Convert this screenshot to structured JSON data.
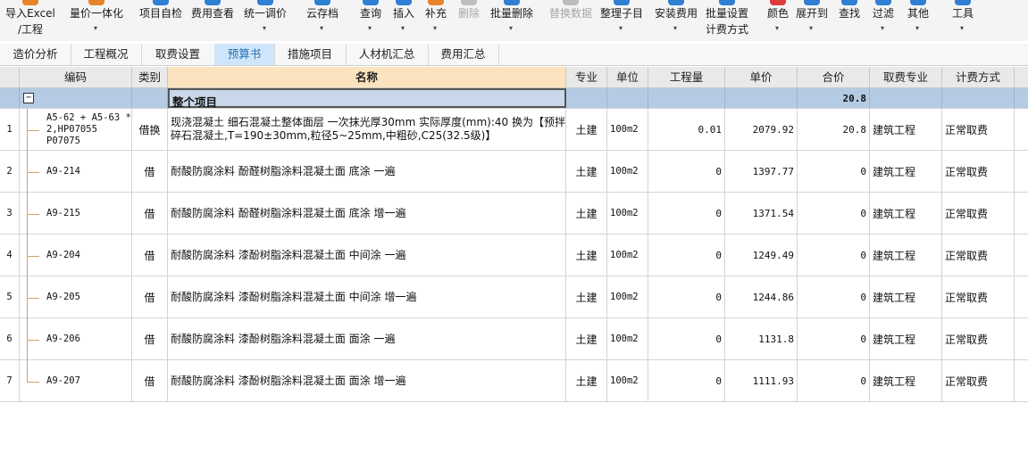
{
  "toolbar": {
    "items": [
      {
        "label": "导入Excel",
        "label2": "/工程",
        "icon": "import-excel-icon",
        "color": "#e6842a",
        "disabled": false,
        "caret": false
      },
      {
        "label": "量价一体化",
        "label2": "",
        "icon": "price-integration-icon",
        "color": "#e6842a",
        "disabled": false,
        "caret": true
      },
      {
        "label": "项目自检",
        "label2": "",
        "icon": "self-check-icon",
        "color": "#2f7fd3",
        "disabled": false,
        "caret": false
      },
      {
        "label": "费用查看",
        "label2": "",
        "icon": "fee-view-icon",
        "color": "#2f7fd3",
        "disabled": false,
        "caret": false
      },
      {
        "label": "统一调价",
        "label2": "",
        "icon": "adjust-price-icon",
        "color": "#2f7fd3",
        "disabled": false,
        "caret": true
      },
      {
        "label": "云存档",
        "label2": "",
        "icon": "cloud-archive-icon",
        "color": "#2f7fd3",
        "disabled": false,
        "caret": true
      },
      {
        "label": "查询",
        "label2": "",
        "icon": "query-icon",
        "color": "#2f7fd3",
        "disabled": false,
        "caret": true
      },
      {
        "label": "插入",
        "label2": "",
        "icon": "insert-icon",
        "color": "#2f7fd3",
        "disabled": false,
        "caret": true
      },
      {
        "label": "补充",
        "label2": "",
        "icon": "supplement-icon",
        "color": "#e6842a",
        "disabled": false,
        "caret": true
      },
      {
        "label": "删除",
        "label2": "",
        "icon": "delete-icon",
        "color": "#bdbdbd",
        "disabled": true,
        "caret": false
      },
      {
        "label": "批量删除",
        "label2": "",
        "icon": "batch-delete-icon",
        "color": "#2f7fd3",
        "disabled": false,
        "caret": true
      },
      {
        "label": "替换数据",
        "label2": "",
        "icon": "replace-data-icon",
        "color": "#bdbdbd",
        "disabled": true,
        "caret": false
      },
      {
        "label": "整理子目",
        "label2": "",
        "icon": "organize-items-icon",
        "color": "#2f7fd3",
        "disabled": false,
        "caret": true
      },
      {
        "label": "安装费用",
        "label2": "",
        "icon": "install-fee-icon",
        "color": "#2f7fd3",
        "disabled": false,
        "caret": true
      },
      {
        "label": "批量设置",
        "label2": "计费方式",
        "icon": "batch-setting-icon",
        "color": "#2f7fd3",
        "disabled": false,
        "caret": false
      },
      {
        "label": "颜色",
        "label2": "",
        "icon": "color-icon",
        "color": "#e03b3b",
        "disabled": false,
        "caret": true
      },
      {
        "label": "展开到",
        "label2": "",
        "icon": "expand-to-icon",
        "color": "#2f7fd3",
        "disabled": false,
        "caret": true
      },
      {
        "label": "查找",
        "label2": "",
        "icon": "find-icon",
        "color": "#2f7fd3",
        "disabled": false,
        "caret": false
      },
      {
        "label": "过滤",
        "label2": "",
        "icon": "filter-icon",
        "color": "#2f7fd3",
        "disabled": false,
        "caret": true
      },
      {
        "label": "其他",
        "label2": "",
        "icon": "other-icon",
        "color": "#2f7fd3",
        "disabled": false,
        "caret": true
      },
      {
        "label": "工具",
        "label2": "",
        "icon": "tools-icon",
        "color": "#2f7fd3",
        "disabled": false,
        "caret": true
      }
    ]
  },
  "tabs": [
    {
      "label": "造价分析",
      "active": false
    },
    {
      "label": "工程概况",
      "active": false
    },
    {
      "label": "取费设置",
      "active": false
    },
    {
      "label": "预算书",
      "active": true
    },
    {
      "label": "措施项目",
      "active": false
    },
    {
      "label": "人材机汇总",
      "active": false
    },
    {
      "label": "费用汇总",
      "active": false
    }
  ],
  "table": {
    "columns": [
      "编码",
      "类别",
      "名称",
      "专业",
      "单位",
      "工程量",
      "单价",
      "合价",
      "取费专业",
      "计费方式"
    ],
    "summary": {
      "collapse": "−",
      "name": "整个项目",
      "total": "20.8"
    },
    "rows": [
      {
        "no": "1",
        "code": "A5-62 + A5-63 * 2,HP07055 P07075",
        "type": "借换",
        "name": "现浇混凝土 细石混凝土整体面层 一次抹光厚30mm 实际厚度(mm):40 换为【预拌碎石混凝土,T=190±30mm,粒径5~25mm,中粗砂,C25(32.5级)】",
        "spec": "土建",
        "unit": "100m2",
        "qty": "0.01",
        "price": "2079.92",
        "total": "20.8",
        "fee_spec": "建筑工程",
        "method": "正常取费"
      },
      {
        "no": "2",
        "code": "A9-214",
        "type": "借",
        "name": "耐酸防腐涂料 酚醛树脂涂料混凝土面 底涂 一遍",
        "spec": "土建",
        "unit": "100m2",
        "qty": "0",
        "price": "1397.77",
        "total": "0",
        "fee_spec": "建筑工程",
        "method": "正常取费"
      },
      {
        "no": "3",
        "code": "A9-215",
        "type": "借",
        "name": "耐酸防腐涂料 酚醛树脂涂料混凝土面 底涂 增一遍",
        "spec": "土建",
        "unit": "100m2",
        "qty": "0",
        "price": "1371.54",
        "total": "0",
        "fee_spec": "建筑工程",
        "method": "正常取费"
      },
      {
        "no": "4",
        "code": "A9-204",
        "type": "借",
        "name": "耐酸防腐涂料 漆酚树脂涂料混凝土面 中间涂 一遍",
        "spec": "土建",
        "unit": "100m2",
        "qty": "0",
        "price": "1249.49",
        "total": "0",
        "fee_spec": "建筑工程",
        "method": "正常取费"
      },
      {
        "no": "5",
        "code": "A9-205",
        "type": "借",
        "name": "耐酸防腐涂料 漆酚树脂涂料混凝土面 中间涂 增一遍",
        "spec": "土建",
        "unit": "100m2",
        "qty": "0",
        "price": "1244.86",
        "total": "0",
        "fee_spec": "建筑工程",
        "method": "正常取费"
      },
      {
        "no": "6",
        "code": "A9-206",
        "type": "借",
        "name": "耐酸防腐涂料 漆酚树脂涂料混凝土面 面涂 一遍",
        "spec": "土建",
        "unit": "100m2",
        "qty": "0",
        "price": "1131.8",
        "total": "0",
        "fee_spec": "建筑工程",
        "method": "正常取费"
      },
      {
        "no": "7",
        "code": "A9-207",
        "type": "借",
        "name": "耐酸防腐涂料 漆酚树脂涂料混凝土面 面涂 增一遍",
        "spec": "土建",
        "unit": "100m2",
        "qty": "0",
        "price": "1111.93",
        "total": "0",
        "fee_spec": "建筑工程",
        "method": "正常取费"
      }
    ]
  }
}
